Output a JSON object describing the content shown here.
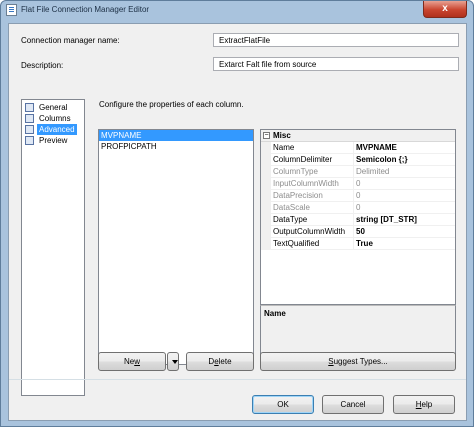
{
  "window": {
    "title": "Flat File Connection Manager Editor",
    "close_glyph": "x"
  },
  "form": {
    "name_label": "Connection manager name:",
    "name_value": "ExtractFlatFile",
    "description_label": "Description:",
    "description_value": "Extarct Falt file from source"
  },
  "nav": {
    "items": [
      {
        "label": "General",
        "icon": "general-icon"
      },
      {
        "label": "Columns",
        "icon": "columns-icon"
      },
      {
        "label": "Advanced",
        "icon": "advanced-icon",
        "selected": true
      },
      {
        "label": "Preview",
        "icon": "preview-icon"
      }
    ]
  },
  "main": {
    "description": "Configure the properties of each column.",
    "columns": [
      "MVPNAME",
      "PROFPICPATH"
    ],
    "selected_column": "MVPNAME"
  },
  "grid": {
    "category": "Misc",
    "toggle_glyph": "−",
    "properties": [
      {
        "name": "Name",
        "value": "MVPNAME"
      },
      {
        "name": "ColumnDelimiter",
        "value": "Semicolon {;}"
      },
      {
        "name": "ColumnType",
        "value": "Delimited"
      },
      {
        "name": "InputColumnWidth",
        "value": "0"
      },
      {
        "name": "DataPrecision",
        "value": "0"
      },
      {
        "name": "DataScale",
        "value": "0"
      },
      {
        "name": "DataType",
        "value": "string [DT_STR]"
      },
      {
        "name": "OutputColumnWidth",
        "value": "50"
      },
      {
        "name": "TextQualified",
        "value": "True"
      }
    ],
    "help_title": "Name"
  },
  "buttons": {
    "new_pre": "Ne",
    "new_u": "w",
    "new_post": "",
    "delete_pre": "D",
    "delete_u": "e",
    "delete_post": "lete",
    "suggest_pre": "",
    "suggest_u": "S",
    "suggest_post": "uggest Types...",
    "ok": "OK",
    "cancel": "Cancel",
    "help_pre": "",
    "help_u": "H",
    "help_post": "elp"
  },
  "colors": {
    "selection": "#3399ff",
    "title_bar": "#a9c3dd",
    "close": "#c9452f"
  }
}
